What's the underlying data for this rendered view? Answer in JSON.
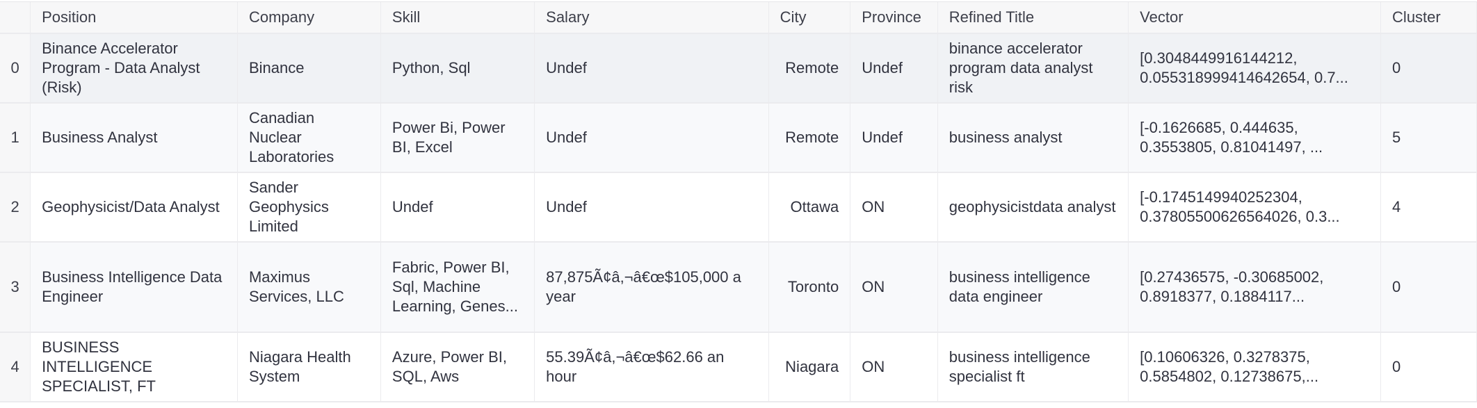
{
  "table": {
    "columns": [
      "",
      "Position",
      "Company",
      "Skill",
      "Salary",
      "City",
      "Province",
      "Refined Title",
      "Vector",
      "Cluster"
    ],
    "rows": [
      {
        "index": "0",
        "position": "Binance Accelerator Program - Data Analyst (Risk)",
        "company": "Binance",
        "skill": "Python, Sql",
        "salary": "Undef",
        "city": "Remote",
        "province": "Undef",
        "refined_title": "binance accelerator program data analyst risk",
        "vector": "[0.3048449916144212, 0.055318999414642654, 0.7...",
        "cluster": "0"
      },
      {
        "index": "1",
        "position": "Business Analyst",
        "company": "Canadian Nuclear Laboratories",
        "skill": "Power Bi, Power BI, Excel",
        "salary": "Undef",
        "city": "Remote",
        "province": "Undef",
        "refined_title": "business analyst",
        "vector": "[-0.1626685, 0.444635, 0.3553805, 0.81041497, ...",
        "cluster": "5"
      },
      {
        "index": "2",
        "position": "Geophysicist/Data Analyst",
        "company": "Sander Geophysics Limited",
        "skill": "Undef",
        "salary": "Undef",
        "city": "Ottawa",
        "province": "ON",
        "refined_title": "geophysicistdata analyst",
        "vector": "[-0.1745149940252304, 0.37805500626564026, 0.3...",
        "cluster": "4"
      },
      {
        "index": "3",
        "position": "Business Intelligence Data Engineer",
        "company": "Maximus Services, LLC",
        "skill": "Fabric, Power BI, Sql, Machine Learning, Genes...",
        "salary": "87,875Ã¢â,¬â€œ$105,000 a year",
        "city": "Toronto",
        "province": "ON",
        "refined_title": "business intelligence data engineer",
        "vector": "[0.27436575, -0.30685002, 0.8918377, 0.1884117...",
        "cluster": "0"
      },
      {
        "index": "4",
        "position": "BUSINESS INTELLIGENCE SPECIALIST, FT",
        "company": "Niagara Health System",
        "skill": "Azure, Power BI, SQL, Aws",
        "salary": "55.39Ã¢â,¬â€œ$62.66 an hour",
        "city": "Niagara",
        "province": "ON",
        "refined_title": "business intelligence specialist ft",
        "vector": "[0.10606326, 0.3278375, 0.5854802, 0.12738675,...",
        "cluster": "0"
      }
    ]
  }
}
